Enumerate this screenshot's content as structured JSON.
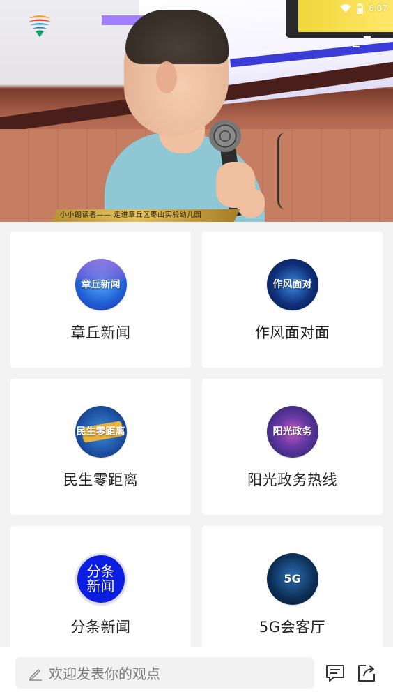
{
  "status_bar": {
    "time": "6:07",
    "icons": [
      "wifi-icon",
      "battery-icon"
    ]
  },
  "video": {
    "caption": "小小朗读者—— 走进章丘区枣山实验幼儿园",
    "logo_icon": "app-logo-icon",
    "expand_icon": "fullscreen-icon"
  },
  "channels": [
    {
      "label": "章丘新闻",
      "icon": "zhangqiu-news-icon",
      "badge_text": "章丘新闻"
    },
    {
      "label": "作风面对面",
      "icon": "zuofeng-icon",
      "badge_text": "作风面对"
    },
    {
      "label": "民生零距离",
      "icon": "minsheng-icon",
      "badge_text": "民生零距离"
    },
    {
      "label": "阳光政务热线",
      "icon": "yangguang-icon",
      "badge_text": "阳光政务"
    },
    {
      "label": "分条新闻",
      "icon": "fentiao-icon",
      "badge_text_1": "分条",
      "badge_text_2": "新闻"
    },
    {
      "label": "5G会客厅",
      "icon": "5g-icon",
      "badge_text": "5G"
    }
  ],
  "comment_bar": {
    "placeholder": "欢迎发表你的观点",
    "pencil_icon": "pencil-icon",
    "comments_icon": "comments-icon",
    "share_icon": "share-icon"
  }
}
